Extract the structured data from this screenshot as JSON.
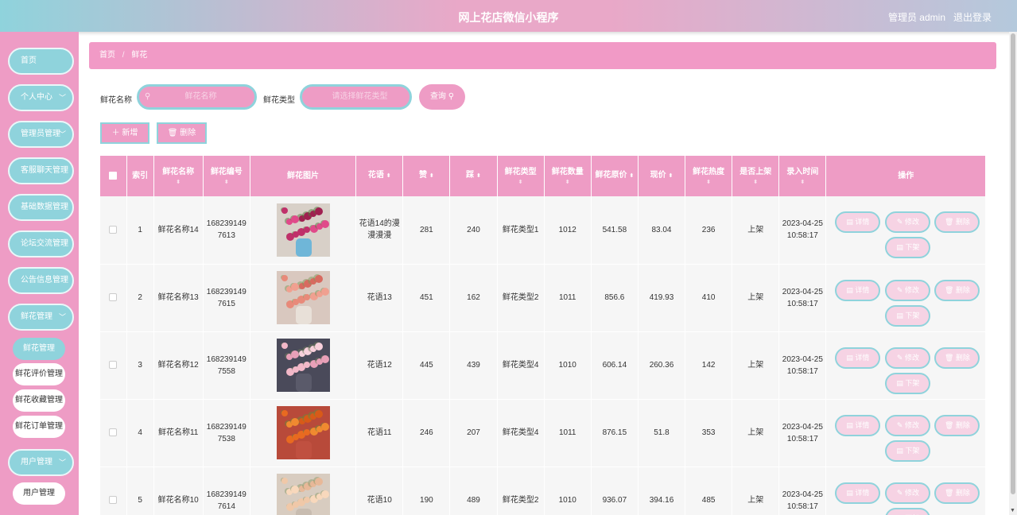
{
  "header": {
    "title": "网上花店微信小程序",
    "user": "管理员 admin",
    "logout": "退出登录"
  },
  "sidebar": {
    "items": [
      "首页",
      "个人中心",
      "管理员管理",
      "客服聊天管理",
      "基础数据管理",
      "论坛交流管理",
      "公告信息管理",
      "鲜花管理"
    ],
    "sub_items": [
      "鲜花管理",
      "鲜花评价管理",
      "鲜花收藏管理",
      "鲜花订单管理"
    ],
    "user_menu": "用户管理",
    "user_sub": "用户管理"
  },
  "breadcrumb": {
    "home": "首页",
    "separator": "/",
    "current": "鲜花"
  },
  "search": {
    "name_label": "鲜花名称",
    "name_placeholder": "鲜花名称",
    "type_label": "鲜花类型",
    "type_placeholder": "请选择鲜花类型",
    "button": "查询"
  },
  "actions": {
    "add": "新增",
    "delete": "删除"
  },
  "table": {
    "headers": [
      "索引",
      "鲜花名称",
      "鲜花编号",
      "鲜花图片",
      "花语",
      "赞",
      "踩",
      "鲜花类型",
      "鲜花数量",
      "鲜花原价",
      "现价",
      "鲜花热度",
      "是否上架",
      "录入时间",
      "操作"
    ],
    "op_labels": {
      "detail": "详情",
      "edit": "修改",
      "delete": "删除",
      "offshelf": "下架"
    },
    "rows": [
      {
        "index": "1",
        "name": "鲜花名称14",
        "code": "1682391497613",
        "huayu": "花语14的漫漫漫漫",
        "like": "281",
        "dislike": "240",
        "type": "鲜花类型1",
        "qty": "1012",
        "orig": "541.58",
        "price": "83.04",
        "heat": "236",
        "onshelf": "上架",
        "time": "2023-04-25 10:58:17"
      },
      {
        "index": "2",
        "name": "鲜花名称13",
        "code": "1682391497615",
        "huayu": "花语13",
        "like": "451",
        "dislike": "162",
        "type": "鲜花类型2",
        "qty": "1011",
        "orig": "856.6",
        "price": "419.93",
        "heat": "410",
        "onshelf": "上架",
        "time": "2023-04-25 10:58:17"
      },
      {
        "index": "3",
        "name": "鲜花名称12",
        "code": "1682391497558",
        "huayu": "花语12",
        "like": "445",
        "dislike": "439",
        "type": "鲜花类型4",
        "qty": "1010",
        "orig": "606.14",
        "price": "260.36",
        "heat": "142",
        "onshelf": "上架",
        "time": "2023-04-25 10:58:17"
      },
      {
        "index": "4",
        "name": "鲜花名称11",
        "code": "1682391497538",
        "huayu": "花语11",
        "like": "246",
        "dislike": "207",
        "type": "鲜花类型4",
        "qty": "1011",
        "orig": "876.15",
        "price": "51.8",
        "heat": "353",
        "onshelf": "上架",
        "time": "2023-04-25 10:58:17"
      },
      {
        "index": "5",
        "name": "鲜花名称10",
        "code": "1682391497614",
        "huayu": "花语10",
        "like": "190",
        "dislike": "489",
        "type": "鲜花类型2",
        "qty": "1010",
        "orig": "936.07",
        "price": "394.16",
        "heat": "485",
        "onshelf": "上架",
        "time": "2023-04-25 10:58:17"
      }
    ]
  },
  "colors": {
    "pink": "#ee9cc5",
    "teal": "#8fd3dc"
  }
}
